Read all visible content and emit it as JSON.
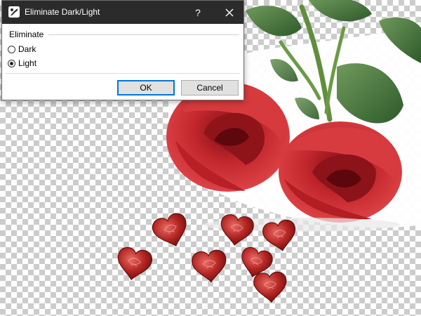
{
  "dialog": {
    "title": "Eliminate Dark/Light",
    "help_label": "?",
    "group_label": "Eliminate",
    "options": [
      {
        "label": "Dark",
        "checked": false
      },
      {
        "label": "Light",
        "checked": true
      }
    ],
    "ok_label": "OK",
    "cancel_label": "Cancel",
    "accent_color": "#0078d7",
    "titlebar_color": "#2b2b2b"
  },
  "icons": {
    "app": "app-logo-icon",
    "close": "close-icon"
  }
}
